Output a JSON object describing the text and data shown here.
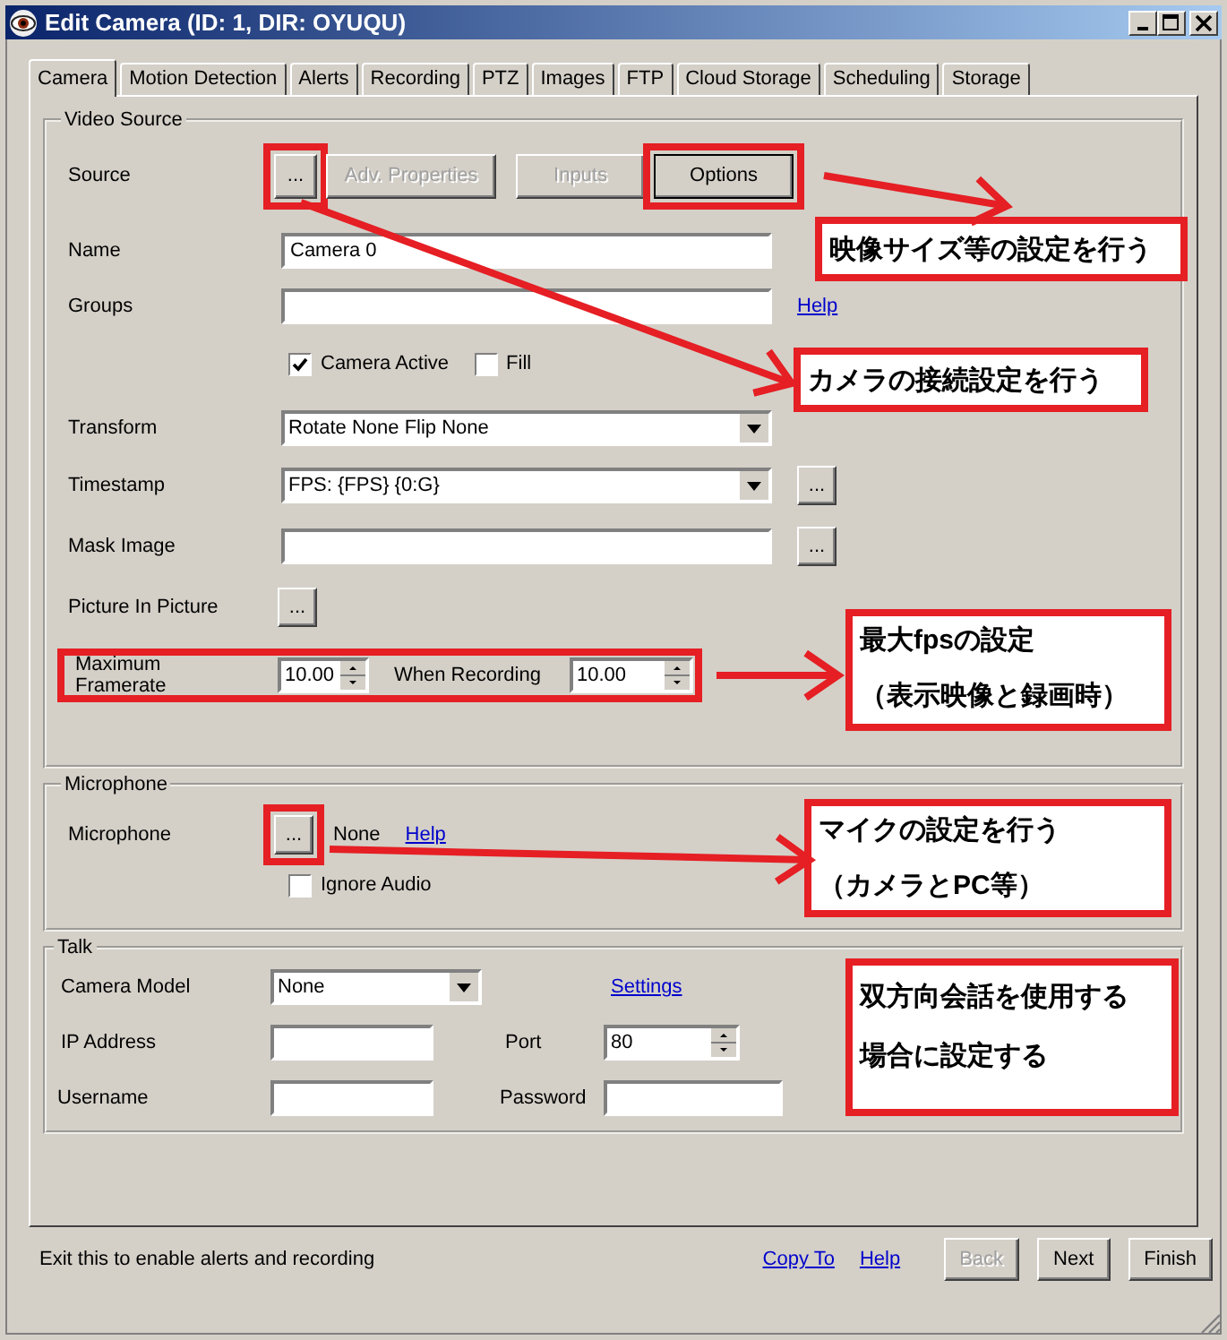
{
  "window": {
    "title": "Edit Camera (ID: 1, DIR: OYUQU)"
  },
  "tabs": [
    {
      "label": "Camera",
      "selected": true
    },
    {
      "label": "Motion Detection",
      "selected": false
    },
    {
      "label": "Alerts",
      "selected": false
    },
    {
      "label": "Recording",
      "selected": false
    },
    {
      "label": "PTZ",
      "selected": false
    },
    {
      "label": "Images",
      "selected": false
    },
    {
      "label": "FTP",
      "selected": false
    },
    {
      "label": "Cloud Storage",
      "selected": false
    },
    {
      "label": "Scheduling",
      "selected": false
    },
    {
      "label": "Storage",
      "selected": false
    }
  ],
  "video_source": {
    "title": "Video Source",
    "source": {
      "label": "Source",
      "buttons": [
        {
          "label": "...",
          "disabled": false,
          "highlighted": true
        },
        {
          "label": "Adv. Properties",
          "disabled": true,
          "highlighted": false
        },
        {
          "label": "Inputs",
          "disabled": true,
          "highlighted": false
        },
        {
          "label": "Options",
          "disabled": false,
          "highlighted": true
        }
      ]
    },
    "name": {
      "label": "Name",
      "value": "Camera 0"
    },
    "groups": {
      "label": "Groups",
      "link": "Help"
    },
    "checkboxes": [
      {
        "label": "Camera Active",
        "checked": true
      },
      {
        "label": "Fill",
        "checked": false
      }
    ],
    "transform": {
      "label": "Transform",
      "value": "Rotate None Flip None"
    },
    "timestamp": {
      "label": "Timestamp",
      "value": "FPS: {FPS} {0:G}",
      "button": "..."
    },
    "mask_image": {
      "label": "Mask Image",
      "button": "..."
    },
    "picture_in_picture": {
      "label": "Picture In Picture",
      "button": "..."
    },
    "framerate": {
      "label": "Maximum Framerate",
      "value": "10.00",
      "recording_label": "When Recording",
      "recording_value": "10.00",
      "highlighted": true
    }
  },
  "microphone": {
    "title": "Microphone",
    "label": "Microphone",
    "button": {
      "label": "...",
      "highlighted": true
    },
    "value": "None",
    "link": "Help",
    "ignore_audio": {
      "label": "Ignore Audio",
      "checked": false
    }
  },
  "talk": {
    "title": "Talk",
    "camera_model": {
      "label": "Camera Model",
      "value": "None"
    },
    "settings_link": "Settings",
    "ip_address": {
      "label": "IP Address"
    },
    "port": {
      "label": "Port",
      "value": "80"
    },
    "username": {
      "label": "Username"
    },
    "password": {
      "label": "Password"
    }
  },
  "footer": {
    "status": "Exit this to enable alerts and recording",
    "links": [
      "Copy To",
      "Help"
    ],
    "buttons": [
      {
        "label": "Back",
        "disabled": true
      },
      {
        "label": "Next",
        "disabled": false
      },
      {
        "label": "Finish",
        "disabled": false
      }
    ]
  },
  "annotations": [
    {
      "lines": [
        "映像サイズ等の設定を行う"
      ]
    },
    {
      "lines": [
        "カメラの接続設定を行う"
      ]
    },
    {
      "lines": [
        "最大fpsの設定",
        "（表示映像と録画時）"
      ]
    },
    {
      "lines": [
        "マイクの設定を行う",
        "（カメラとPC等）"
      ]
    },
    {
      "lines": [
        "双方向会話を使用する",
        "場合に設定する"
      ]
    }
  ]
}
